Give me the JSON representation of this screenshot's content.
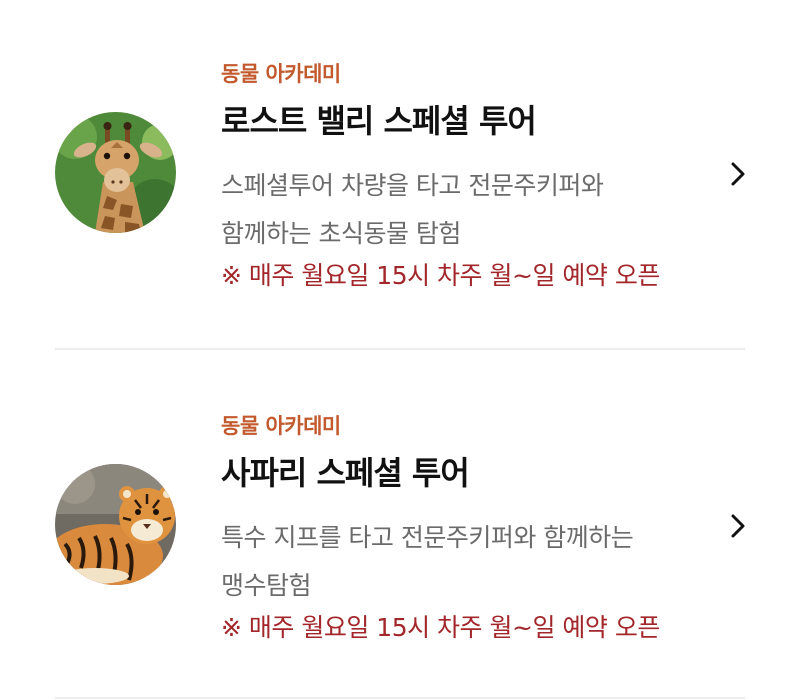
{
  "tours": [
    {
      "category": "동물 아카데미",
      "title": "로스트 밸리 스페셜 투어",
      "description_lines": [
        "스페셜투어 차량을 타고 전문주키퍼와",
        "함께하는 초식동물 탐험"
      ],
      "notice": "※ 매주 월요일 15시 차주 월~일 예약 오픈",
      "thumbnail_icon": "giraffe-photo",
      "arrow_icon": "chevron-right-icon"
    },
    {
      "category": "동물 아카데미",
      "title": "사파리 스페셜 투어",
      "description_lines": [
        "특수 지프를 타고 전문주키퍼와 함께하는",
        "맹수탐험"
      ],
      "notice": "※ 매주 월요일 15시 차주 월~일 예약 오픈",
      "thumbnail_icon": "tiger-photo",
      "arrow_icon": "chevron-right-icon"
    }
  ],
  "colors": {
    "category": "#c35a2e",
    "title": "#111111",
    "description": "#6b6b6b",
    "notice": "#a3262a",
    "divider": "#ececec"
  }
}
